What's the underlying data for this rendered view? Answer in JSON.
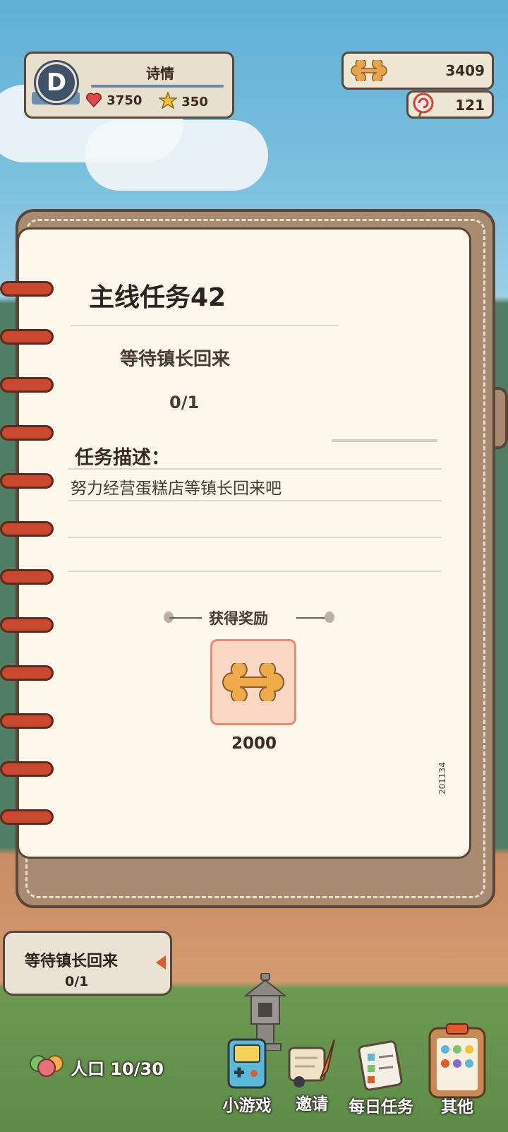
{
  "profile": {
    "avatar_letter": "D",
    "name": "诗情",
    "hearts": "3750",
    "stars": "350"
  },
  "resources": {
    "bones": "3409",
    "candy": "121"
  },
  "quest_card": {
    "title": "主线任务42",
    "goal": "等待镇长回来",
    "progress": "0/1",
    "desc_heading": "任务描述：",
    "description": "努力经营蛋糕店等镇长回来吧",
    "reward_heading": "获得奖励",
    "reward_qty": "2000",
    "code": "201134"
  },
  "quest_tracker": {
    "title": "等待镇长回来",
    "progress": "0/1"
  },
  "population": "人口 10/30",
  "nav": {
    "minigame": "小游戏",
    "invite": "邀请",
    "daily": "每日任务",
    "other": "其他"
  },
  "colors": {
    "accent": "#e35a2a",
    "frame": "#5a4636",
    "page": "#fdf7ec",
    "reward_bg": "#fbd8c6"
  }
}
